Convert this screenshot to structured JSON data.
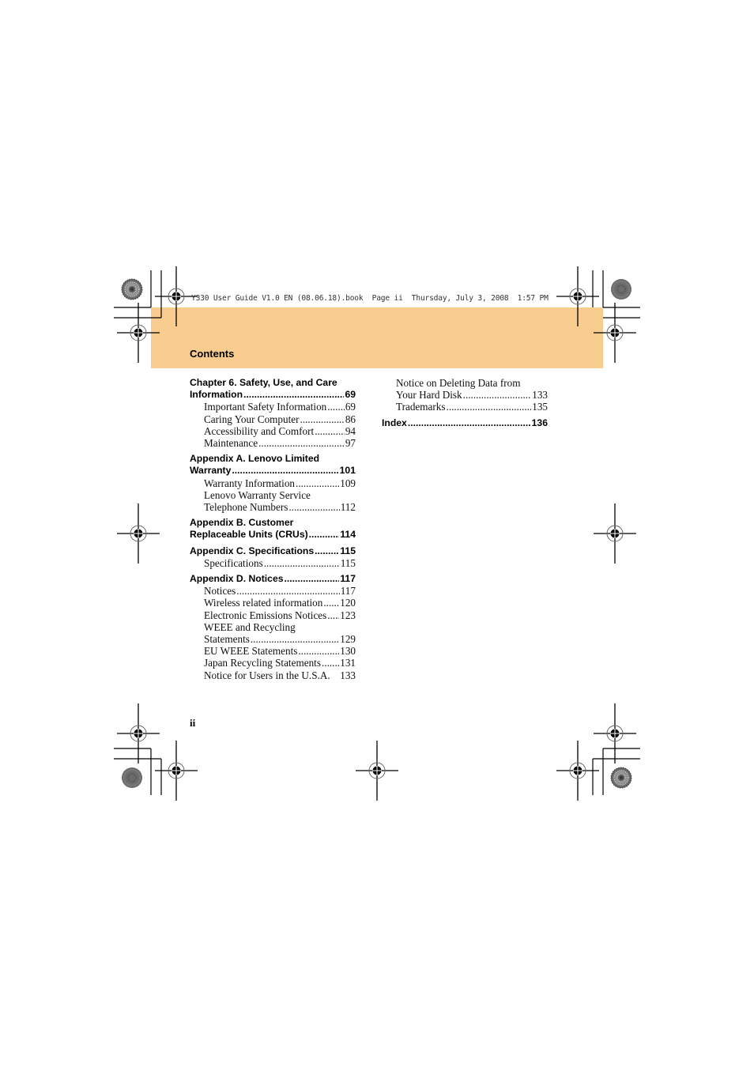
{
  "slug": "Y330 User Guide V1.0 EN (08.06.18).book  Page ii  Thursday, July 3, 2008  1:57 PM",
  "header": {
    "title": "Contents",
    "band_color": "#f8cb8e"
  },
  "toc_left": {
    "ch6": {
      "line1": "Chapter 6. Safety, Use, and Care",
      "line2": "Information",
      "page": "69",
      "items": [
        {
          "label": "Important Safety Information",
          "page": "69"
        },
        {
          "label": "Caring Your Computer",
          "page": "86"
        },
        {
          "label": "Accessibility and Comfort",
          "page": "94"
        },
        {
          "label": "Maintenance",
          "page": "97"
        }
      ]
    },
    "appA": {
      "line1": "Appendix A. Lenovo Limited",
      "line2": "Warranty",
      "page": "101",
      "items": [
        {
          "label": "Warranty Information",
          "page": "109"
        },
        {
          "line1": "Lenovo Warranty Service",
          "label": "Telephone Numbers",
          "page": "112"
        }
      ]
    },
    "appB": {
      "line1": "Appendix B. Customer",
      "line2": "Replaceable Units (CRUs)",
      "page": "114"
    },
    "appC": {
      "label": "Appendix C. Specifications",
      "page": "115",
      "items": [
        {
          "label": "Specifications",
          "page": "115"
        }
      ]
    },
    "appD": {
      "label": "Appendix D. Notices",
      "page": "117",
      "items": [
        {
          "label": "Notices",
          "page": "117"
        },
        {
          "label": "Wireless related information",
          "page": "120"
        },
        {
          "label": "Electronic Emissions Notices",
          "page": "123"
        },
        {
          "line1": "WEEE and Recycling",
          "label": "Statements",
          "page": "129"
        },
        {
          "label": "EU WEEE Statements",
          "page": "130"
        },
        {
          "label": "Japan Recycling Statements",
          "page": "131"
        },
        {
          "label": "Notice for Users in the U.S.A.",
          "page": "133"
        }
      ]
    }
  },
  "toc_right": {
    "items": [
      {
        "line1": "Notice on Deleting Data from",
        "label": "Your Hard Disk",
        "page": "133"
      },
      {
        "label": "Trademarks",
        "page": "135"
      }
    ],
    "index": {
      "label": "Index",
      "page": "136"
    }
  },
  "footer": {
    "folio": "ii"
  },
  "marks": {
    "registration": "registration-crosshair-icon",
    "color_target": "color-target-icon"
  }
}
